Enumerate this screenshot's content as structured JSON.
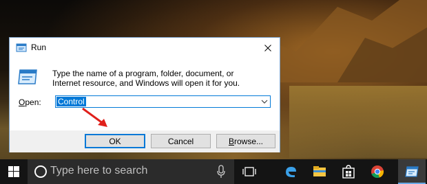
{
  "dialog": {
    "title": "Run",
    "prompt_line1": "Type the name of a program, folder, document, or",
    "prompt_line2": "Internet resource, and Windows will open it for you.",
    "open_label_prefix": "O",
    "open_label_rest": "pen:",
    "open_value": "Control",
    "ok_label": "OK",
    "cancel_label": "Cancel",
    "browse_label_prefix": "B",
    "browse_label_rest": "rowse..."
  },
  "taskbar": {
    "search_placeholder": "Type here to search",
    "pinned": [
      "task-view-icon",
      "edge-icon",
      "file-explorer-icon",
      "store-icon",
      "chrome-icon",
      "run-icon"
    ]
  },
  "colors": {
    "accent": "#0078d7",
    "taskbar": "#141414",
    "search_box": "#2b2b2b",
    "arrow": "#e0201b"
  }
}
